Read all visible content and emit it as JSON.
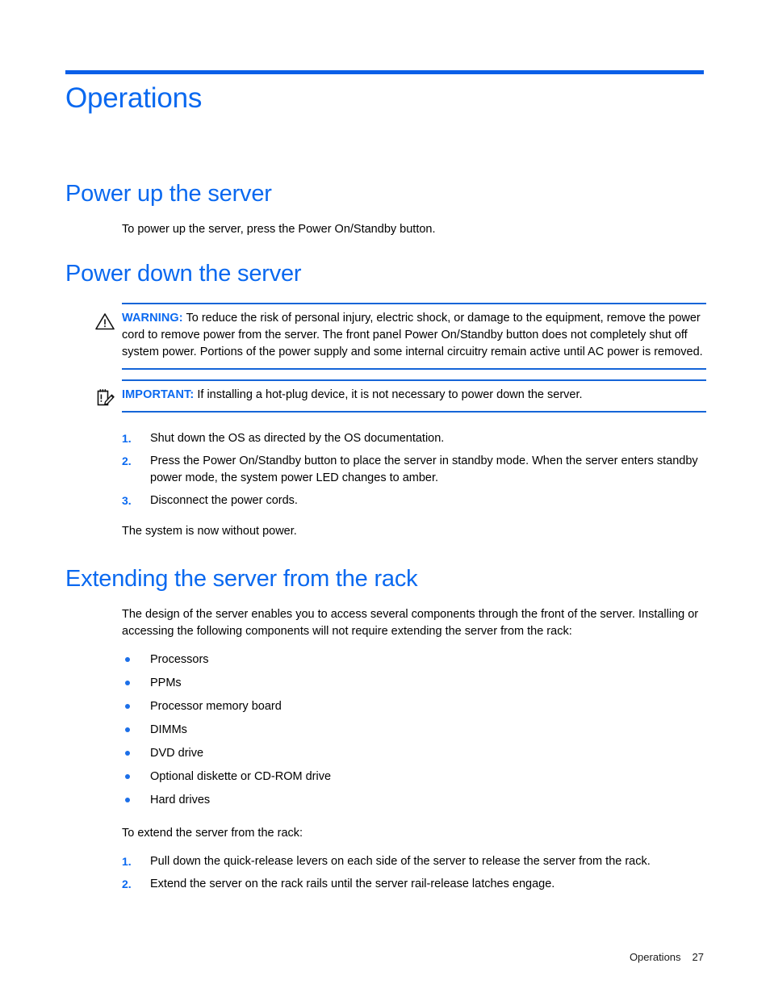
{
  "colors": {
    "heading_blue": "#0A69F0",
    "rule_blue": "#0A5FE8",
    "notice_rule_blue": "#1565D8",
    "bullet_blue": "#1C6FE8",
    "body_black": "#000000"
  },
  "chapter": {
    "title": "Operations"
  },
  "sections": [
    {
      "heading": "Power up the server",
      "paragraph": "To power up the server, press the Power On/Standby button."
    },
    {
      "heading": "Power down the server"
    },
    {
      "heading": "Extending the server from the rack"
    }
  ],
  "notices": [
    {
      "icon": "warning-triangle-icon",
      "label": "WARNING:",
      "text": "To reduce the risk of personal injury, electric shock, or damage to the equipment, remove the power cord to remove power from the server. The front panel Power On/Standby button does not completely shut off system power. Portions of the power supply and some internal circuitry remain active until AC power is removed."
    },
    {
      "icon": "important-note-icon",
      "label": "IMPORTANT:",
      "text": "If installing a hot-plug device, it is not necessary to power down the server."
    }
  ],
  "power_down_steps": [
    {
      "num": "1.",
      "text": "Shut down the OS as directed by the OS documentation."
    },
    {
      "num": "2.",
      "text": "Press the Power On/Standby button to place the server in standby mode. When the server enters standby power mode, the system power LED changes to amber."
    },
    {
      "num": "3.",
      "text": "Disconnect the power cords."
    }
  ],
  "power_down_closing": "The system is now without power.",
  "extending": {
    "intro": "The design of the server enables you to access several components through the front of the server. Installing or accessing the following components will not require extending the server from the rack:",
    "bullets": [
      "Processors",
      "PPMs",
      "Processor memory board",
      "DIMMs",
      "DVD drive",
      "Optional diskette or CD-ROM drive",
      "Hard drives"
    ],
    "lead_in": "To extend the server from the rack:",
    "steps": [
      {
        "num": "1.",
        "text": "Pull down the quick-release levers on each side of the server to release the server from the rack."
      },
      {
        "num": "2.",
        "text": "Extend the server on the rack rails until the server rail-release latches engage."
      }
    ]
  },
  "footer": {
    "label": "Operations",
    "page": "27"
  }
}
